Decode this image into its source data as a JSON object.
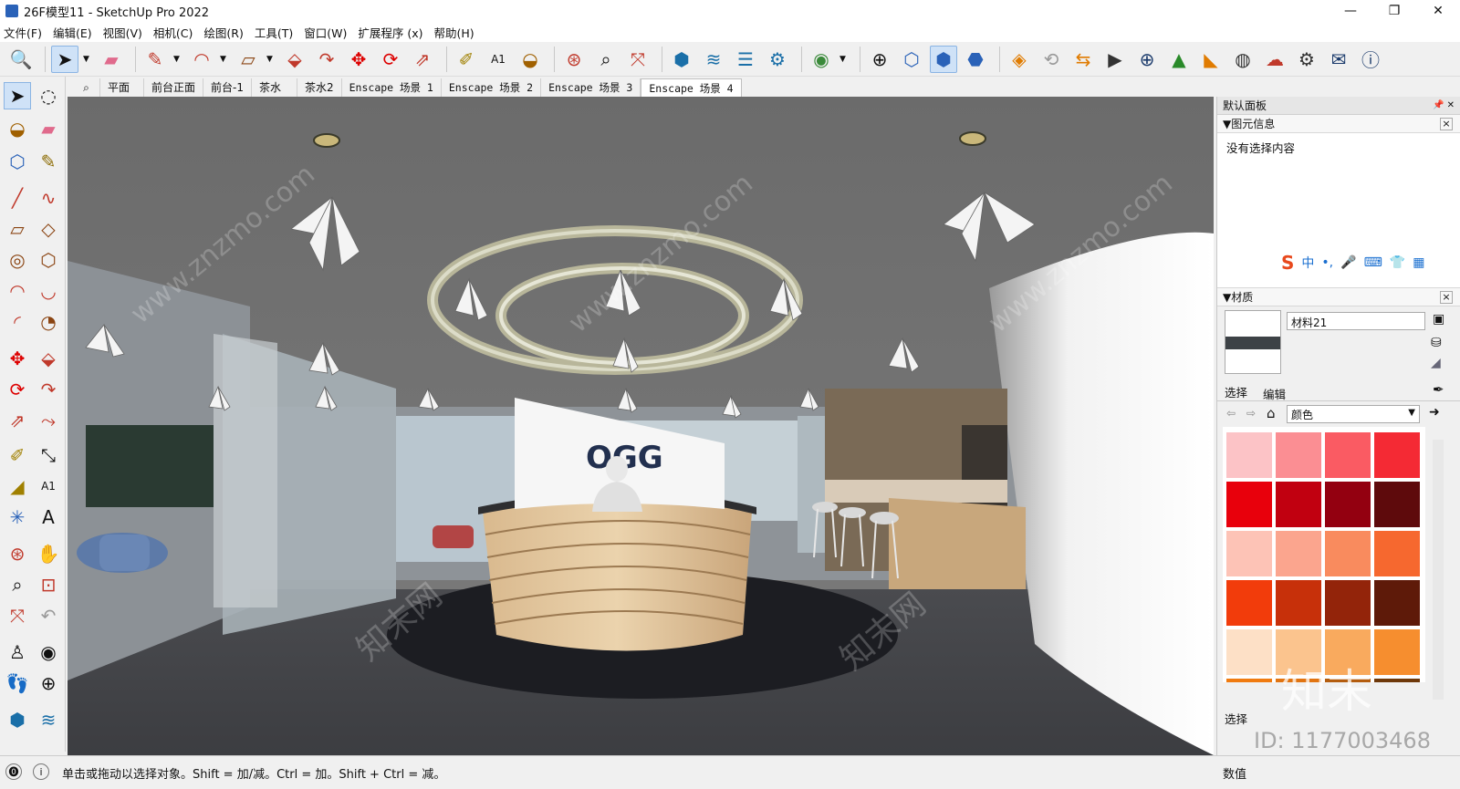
{
  "window": {
    "title": "26F模型11 - SketchUp Pro 2022",
    "minimize": "—",
    "maximize": "❐",
    "close": "✕"
  },
  "menu": [
    "文件(F)",
    "编辑(E)",
    "视图(V)",
    "相机(C)",
    "绘图(R)",
    "工具(T)",
    "窗口(W)",
    "扩展程序 (x)",
    "帮助(H)"
  ],
  "scene_tabs": [
    {
      "label": "平面",
      "mono": false
    },
    {
      "label": "前台正面",
      "mono": false
    },
    {
      "label": "前台-1",
      "mono": false
    },
    {
      "label": "茶水",
      "mono": false
    },
    {
      "label": "茶水2",
      "mono": false
    },
    {
      "label": "Enscape 场景 1",
      "mono": true
    },
    {
      "label": "Enscape 场景 2",
      "mono": true
    },
    {
      "label": "Enscape 场景 3",
      "mono": true
    },
    {
      "label": "Enscape 场景 4",
      "mono": true,
      "active": true
    }
  ],
  "tray": {
    "title": "默认面板",
    "entity_info": {
      "title": "图元信息",
      "empty_text": "没有选择内容"
    },
    "materials": {
      "title": "材质",
      "material_name": "材料21",
      "tab_select": "选择",
      "tab_edit": "编辑",
      "library": "颜色",
      "bottom_label": "选择"
    }
  },
  "ime": [
    "中",
    "•,",
    "🎤",
    "⌨",
    "👕",
    "▦"
  ],
  "swatch_colors": [
    [
      "#fcc3c6",
      "#fb8e93",
      "#fa5b63",
      "#f42a34"
    ],
    [
      "#e8000c",
      "#c10010",
      "#930010",
      "#5e0a0c"
    ],
    [
      "#fdc3b6",
      "#fba58e",
      "#f98b5e",
      "#f6682f"
    ],
    [
      "#f23c0b",
      "#c7300a",
      "#93240a",
      "#5e1a09"
    ],
    [
      "#fde0c6",
      "#fbc48e",
      "#f9aa5e",
      "#f68e2f"
    ],
    [
      "#f07b10",
      "#e17411",
      "#b45d0f",
      "#6e380a"
    ]
  ],
  "viewport": {
    "logo_text": "OGG",
    "watermarks": [
      "www.znzmo.com",
      "知末网",
      "www.znzmo.com",
      "知末网",
      "www.znzmo.com"
    ]
  },
  "status": {
    "message": "单击或拖动以选择对象。Shift = 加/减。Ctrl = 加。Shift + Ctrl = 减。",
    "vcb_label": "数值",
    "id_overlay": "ID: 1177003468",
    "brand_overlay": "知末"
  }
}
